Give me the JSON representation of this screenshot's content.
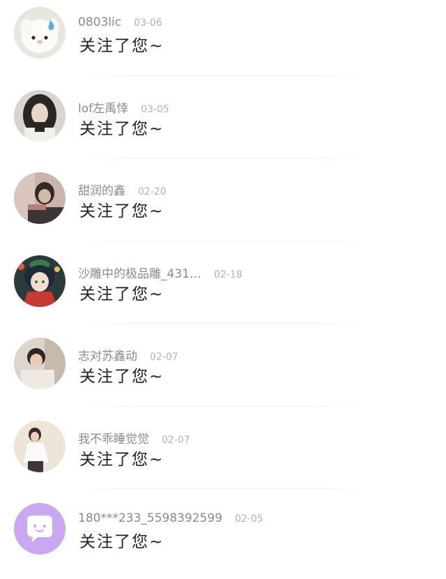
{
  "notifications": [
    {
      "name": "0803lic",
      "date": "03-06",
      "message": "关注了您~",
      "avatar_icon": "white-mascot-avatar"
    },
    {
      "name": "lof左禹悻",
      "date": "03-05",
      "message": "关注了您~",
      "avatar_icon": "girl-photo-avatar"
    },
    {
      "name": "甜润的鑫",
      "date": "02-20",
      "message": "关注了您~",
      "avatar_icon": "boy-photo-avatar"
    },
    {
      "name": "沙雕中的极品雕_431…",
      "date": "02-18",
      "message": "关注了您~",
      "avatar_icon": "anime-character-avatar"
    },
    {
      "name": "志对苏鑫动",
      "date": "02-07",
      "message": "关注了您~",
      "avatar_icon": "boy-photo-avatar"
    },
    {
      "name": "我不乖睡觉觉",
      "date": "02-07",
      "message": "关注了您~",
      "avatar_icon": "person-photo-avatar"
    },
    {
      "name": "180***233_5598392599",
      "date": "02-05",
      "message": "关注了您~",
      "avatar_icon": "chat-bubble-avatar"
    }
  ],
  "colors": {
    "default_avatar_bg": "#c9a8f2",
    "name_text": "#8a8a8a",
    "date_text": "#b3b3b3",
    "message_text": "#222222"
  }
}
